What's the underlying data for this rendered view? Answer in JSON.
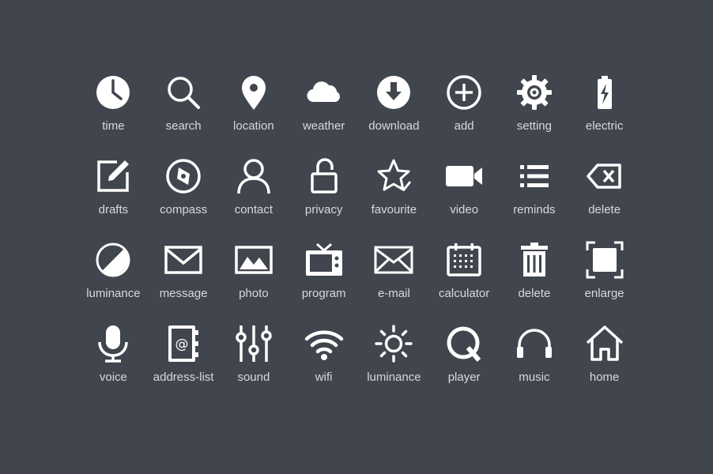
{
  "icons": [
    {
      "label": "time",
      "icon": "clock-icon"
    },
    {
      "label": "search",
      "icon": "magnifier-icon"
    },
    {
      "label": "location",
      "icon": "map-pin-icon"
    },
    {
      "label": "weather",
      "icon": "cloud-icon"
    },
    {
      "label": "download",
      "icon": "download-arrow-icon"
    },
    {
      "label": "add",
      "icon": "plus-circle-icon"
    },
    {
      "label": "setting",
      "icon": "gear-icon"
    },
    {
      "label": "electric",
      "icon": "battery-icon"
    },
    {
      "label": "drafts",
      "icon": "edit-square-icon"
    },
    {
      "label": "compass",
      "icon": "compass-icon"
    },
    {
      "label": "contact",
      "icon": "person-icon"
    },
    {
      "label": "privacy",
      "icon": "unlocked-padlock-icon"
    },
    {
      "label": "favourite",
      "icon": "star-check-icon"
    },
    {
      "label": "video",
      "icon": "video-camera-icon"
    },
    {
      "label": "reminds",
      "icon": "list-icon"
    },
    {
      "label": "delete",
      "icon": "backspace-icon"
    },
    {
      "label": "luminance",
      "icon": "contrast-icon"
    },
    {
      "label": "message",
      "icon": "envelope-icon"
    },
    {
      "label": "photo",
      "icon": "picture-icon"
    },
    {
      "label": "program",
      "icon": "television-icon"
    },
    {
      "label": "e-mail",
      "icon": "mail-outline-icon"
    },
    {
      "label": "calculator",
      "icon": "calendar-grid-icon"
    },
    {
      "label": "delete",
      "icon": "trash-can-icon"
    },
    {
      "label": "enlarge",
      "icon": "fullscreen-icon"
    },
    {
      "label": "voice",
      "icon": "microphone-icon"
    },
    {
      "label": "address-list",
      "icon": "address-book-icon"
    },
    {
      "label": "sound",
      "icon": "equalizer-sliders-icon"
    },
    {
      "label": "wifi",
      "icon": "wifi-icon"
    },
    {
      "label": "luminance",
      "icon": "sun-icon"
    },
    {
      "label": "player",
      "icon": "q-player-icon"
    },
    {
      "label": "music",
      "icon": "headphones-icon"
    },
    {
      "label": "home",
      "icon": "house-icon"
    }
  ],
  "colors": {
    "background": "#41454d",
    "icon": "#ffffff",
    "label": "#d7d9dd"
  }
}
